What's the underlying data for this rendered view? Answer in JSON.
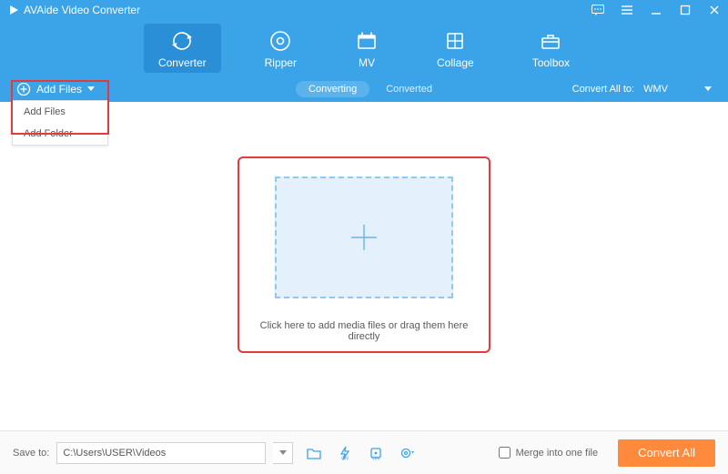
{
  "app": {
    "title": "AVAide Video Converter"
  },
  "nav": {
    "converter": "Converter",
    "ripper": "Ripper",
    "mv": "MV",
    "collage": "Collage",
    "toolbox": "Toolbox"
  },
  "subbar": {
    "add_files_label": "Add Files",
    "converting_tab": "Converting",
    "converted_tab": "Converted",
    "convert_all_to_label": "Convert All to:",
    "target_format": "WMV"
  },
  "add_dropdown": {
    "add_files": "Add Files",
    "add_folder": "Add Folder"
  },
  "main": {
    "drop_instruction": "Click here to add media files or drag them here directly"
  },
  "bottombar": {
    "save_to_label": "Save to:",
    "path_value": "C:\\Users\\USER\\Videos",
    "merge_label": "Merge into one file",
    "convert_all_label": "Convert All"
  },
  "colors": {
    "primary": "#3ba3e8",
    "accent": "#ff8a3c",
    "highlight_border": "#e33b3b"
  }
}
